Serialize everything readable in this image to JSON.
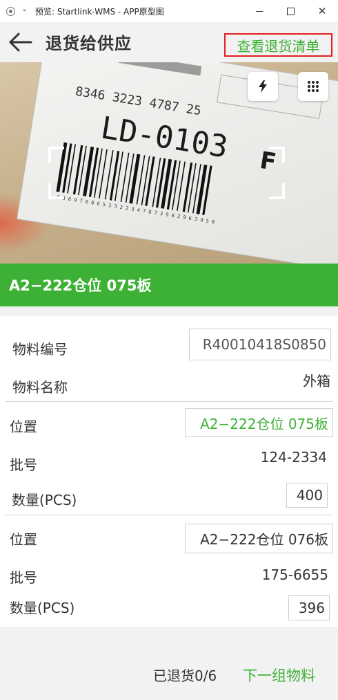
{
  "window": {
    "title": "预览: Startlink-WMS - APP原型图",
    "minimize_icon": "minimize-icon",
    "maximize_icon": "maximize-icon",
    "close_glyph": "✕"
  },
  "header": {
    "title": "退货给供应",
    "back_icon": "arrow-left-icon",
    "view_list_label": "查看退货清单"
  },
  "camera": {
    "label_text_top": "8346 3223 4787 25",
    "label_code": "LD-0103",
    "label_letter": "F",
    "label_small_digits": "8 8 6 9 7 6  8 6 5 3  3 2 2 3  4 7 8 7  3 9 8  2 9 6  3 9 5  8",
    "flash_icon": "flash-icon",
    "grid_icon": "grid-icon"
  },
  "banner": {
    "location": "A2−222仓位 075板"
  },
  "material": {
    "code_label": "物料编号",
    "code_value": "R40010418S0850",
    "name_label": "物料名称",
    "name_value": "外箱"
  },
  "locations": [
    {
      "position_label": "位置",
      "position_value": "A2−222仓位 075板",
      "batch_label": "批号",
      "batch_value": "124-2334",
      "qty_label": "数量(PCS)",
      "qty_value": "400"
    },
    {
      "position_label": "位置",
      "position_value": "A2−222仓位 076板",
      "batch_label": "批号",
      "batch_value": "175-6655",
      "qty_label": "数量(PCS)",
      "qty_value": "396"
    }
  ],
  "footer": {
    "returned_status": "已退货0/6",
    "next_label": "下一组物料"
  },
  "colors": {
    "accent": "#3db135",
    "highlight_border": "#e02020"
  }
}
